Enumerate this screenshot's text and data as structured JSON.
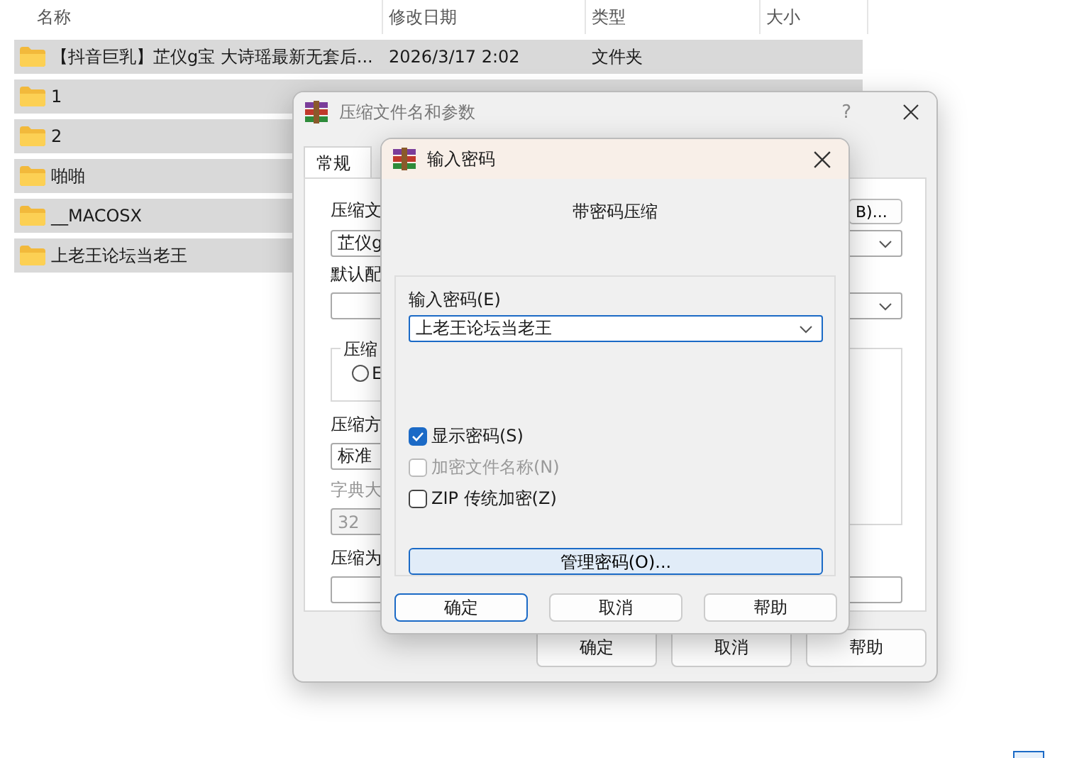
{
  "file_list": {
    "columns": [
      "名称",
      "修改日期",
      "类型",
      "大小"
    ],
    "rows": [
      {
        "name": "【抖音巨乳】芷仪g宝 大诗瑶最新无套后...",
        "date": "2026/3/17 2:02",
        "type": "文件夹",
        "selected": true
      },
      {
        "name": "1",
        "selected": true
      },
      {
        "name": "2",
        "selected": true
      },
      {
        "name": "啪啪",
        "selected": true
      },
      {
        "name": "__MACOSX",
        "selected": true
      },
      {
        "name": "上老王论坛当老王",
        "selected": true
      }
    ]
  },
  "back_dialog": {
    "title": "压缩文件名和参数",
    "help_button": "?",
    "tabs": [
      {
        "label": "常规",
        "selected": true
      }
    ],
    "archive_name": {
      "label": "压缩文",
      "value": "芷仪g",
      "browse_button": "B)..."
    },
    "profile": {
      "label": "默认配"
    },
    "format_group": {
      "label": "压缩",
      "option": "E",
      "option_selected": false
    },
    "method": {
      "label": "压缩方",
      "value": "标准"
    },
    "dictionary": {
      "label": "字典大",
      "value": "32",
      "disabled": true
    },
    "split": {
      "label": "压缩为"
    },
    "buttons": [
      "确定",
      "取消",
      "帮助"
    ]
  },
  "front_dialog": {
    "title": "输入密码",
    "heading": "带密码压缩",
    "password": {
      "label": "输入密码(E)",
      "value": "上老王论坛当老王"
    },
    "options": [
      {
        "label": "显示密码(S)",
        "checked": true,
        "disabled": false
      },
      {
        "label": "加密文件名称(N)",
        "checked": false,
        "disabled": true
      },
      {
        "label": "ZIP 传统加密(Z)",
        "checked": false,
        "disabled": false
      }
    ],
    "manage_button": "管理密码(O)...",
    "buttons": [
      {
        "label": "确定",
        "default": true
      },
      {
        "label": "取消",
        "default": false
      },
      {
        "label": "帮助",
        "default": false
      }
    ]
  }
}
